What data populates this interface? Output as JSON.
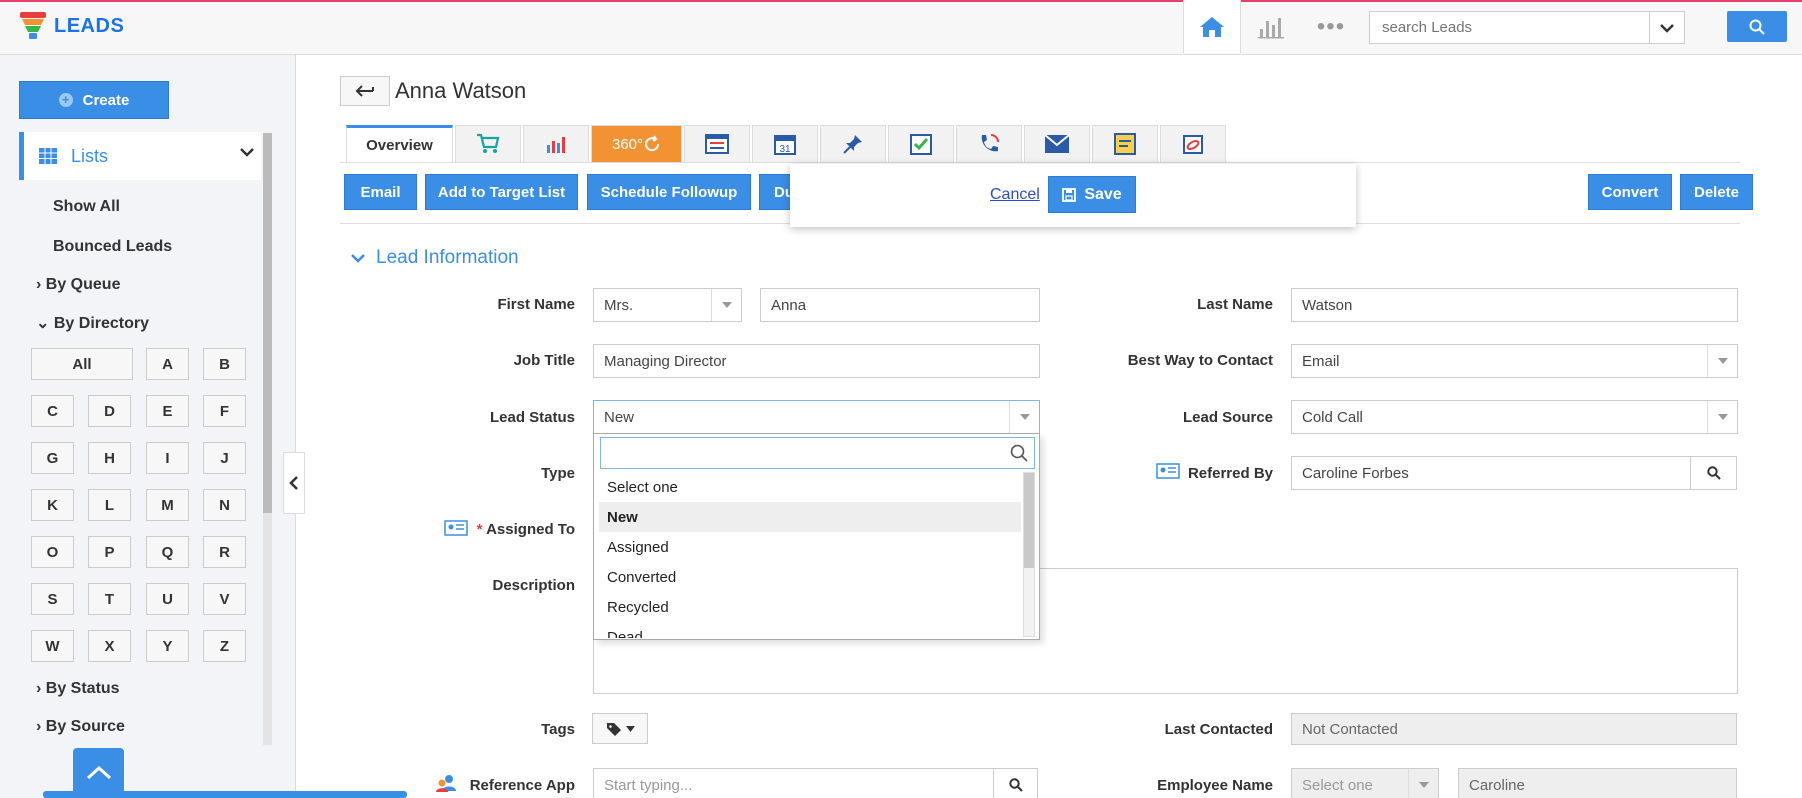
{
  "header": {
    "app_title": "LEADS",
    "search_placeholder": "search Leads",
    "accent": "#3a8ee6",
    "top_stripe": "#e63e6d"
  },
  "sidebar": {
    "create_label": "Create",
    "lists_label": "Lists",
    "links": [
      "Show All",
      "Bounced Leads"
    ],
    "by_queue": "By Queue",
    "by_directory": "By Directory",
    "directory_letters": [
      "All",
      "A",
      "B",
      "C",
      "D",
      "E",
      "F",
      "G",
      "H",
      "I",
      "J",
      "K",
      "L",
      "M",
      "N",
      "O",
      "P",
      "Q",
      "R",
      "S",
      "T",
      "U",
      "V",
      "W",
      "X",
      "Y",
      "Z"
    ],
    "by_status": "By Status",
    "by_source": "By Source"
  },
  "record": {
    "title": "Anna Watson"
  },
  "tabs": {
    "overview": "Overview",
    "t360": "360°",
    "icons": [
      "cart-icon",
      "bar-chart-icon",
      "360-icon",
      "list-card-icon",
      "calendar-icon",
      "pin-icon",
      "task-icon",
      "phone-icon",
      "mail-icon",
      "note-icon",
      "attachment-icon"
    ]
  },
  "actions": {
    "email": "Email",
    "add_target": "Add to Target List",
    "schedule": "Schedule Followup",
    "dup": "Du",
    "convert": "Convert",
    "delete": "Delete"
  },
  "popup": {
    "cancel": "Cancel",
    "save": "Save"
  },
  "section": {
    "title": "Lead Information"
  },
  "form": {
    "first_name_label": "First Name",
    "salutation": "Mrs.",
    "first_name": "Anna",
    "last_name_label": "Last Name",
    "last_name": "Watson",
    "job_title_label": "Job Title",
    "job_title": "Managing Director",
    "best_way_label": "Best Way to Contact",
    "best_way": "Email",
    "lead_status_label": "Lead Status",
    "lead_status": "New",
    "lead_source_label": "Lead Source",
    "lead_source": "Cold Call",
    "type_label": "Type",
    "referred_by_label": "Referred By",
    "referred_by": "Caroline Forbes",
    "assigned_to_label": "Assigned To",
    "required_mark": "*",
    "description_label": "Description",
    "tags_label": "Tags",
    "last_contacted_label": "Last Contacted",
    "last_contacted": "Not Contacted",
    "reference_app_label": "Reference App",
    "reference_app_placeholder": "Start typing...",
    "employee_name_label": "Employee Name",
    "employee_select": "Select one",
    "employee_name": "Caroline"
  },
  "status_dropdown": {
    "search_value": "",
    "options": [
      "Select one",
      "New",
      "Assigned",
      "Converted",
      "Recycled",
      "Dead"
    ],
    "selected": "New"
  }
}
